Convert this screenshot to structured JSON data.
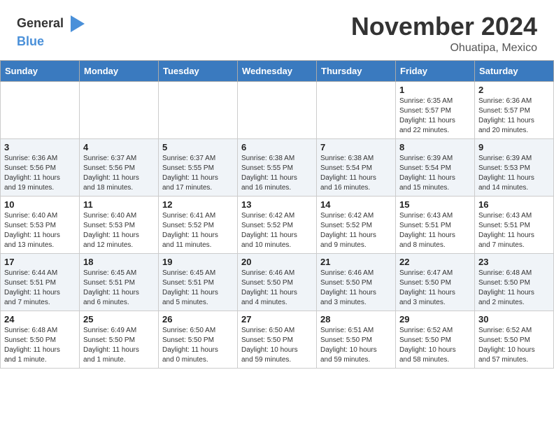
{
  "header": {
    "logo_general": "General",
    "logo_blue": "Blue",
    "month": "November 2024",
    "location": "Ohuatipa, Mexico"
  },
  "days_of_week": [
    "Sunday",
    "Monday",
    "Tuesday",
    "Wednesday",
    "Thursday",
    "Friday",
    "Saturday"
  ],
  "weeks": [
    [
      {
        "day": "",
        "info": ""
      },
      {
        "day": "",
        "info": ""
      },
      {
        "day": "",
        "info": ""
      },
      {
        "day": "",
        "info": ""
      },
      {
        "day": "",
        "info": ""
      },
      {
        "day": "1",
        "info": "Sunrise: 6:35 AM\nSunset: 5:57 PM\nDaylight: 11 hours\nand 22 minutes."
      },
      {
        "day": "2",
        "info": "Sunrise: 6:36 AM\nSunset: 5:57 PM\nDaylight: 11 hours\nand 20 minutes."
      }
    ],
    [
      {
        "day": "3",
        "info": "Sunrise: 6:36 AM\nSunset: 5:56 PM\nDaylight: 11 hours\nand 19 minutes."
      },
      {
        "day": "4",
        "info": "Sunrise: 6:37 AM\nSunset: 5:56 PM\nDaylight: 11 hours\nand 18 minutes."
      },
      {
        "day": "5",
        "info": "Sunrise: 6:37 AM\nSunset: 5:55 PM\nDaylight: 11 hours\nand 17 minutes."
      },
      {
        "day": "6",
        "info": "Sunrise: 6:38 AM\nSunset: 5:55 PM\nDaylight: 11 hours\nand 16 minutes."
      },
      {
        "day": "7",
        "info": "Sunrise: 6:38 AM\nSunset: 5:54 PM\nDaylight: 11 hours\nand 16 minutes."
      },
      {
        "day": "8",
        "info": "Sunrise: 6:39 AM\nSunset: 5:54 PM\nDaylight: 11 hours\nand 15 minutes."
      },
      {
        "day": "9",
        "info": "Sunrise: 6:39 AM\nSunset: 5:53 PM\nDaylight: 11 hours\nand 14 minutes."
      }
    ],
    [
      {
        "day": "10",
        "info": "Sunrise: 6:40 AM\nSunset: 5:53 PM\nDaylight: 11 hours\nand 13 minutes."
      },
      {
        "day": "11",
        "info": "Sunrise: 6:40 AM\nSunset: 5:53 PM\nDaylight: 11 hours\nand 12 minutes."
      },
      {
        "day": "12",
        "info": "Sunrise: 6:41 AM\nSunset: 5:52 PM\nDaylight: 11 hours\nand 11 minutes."
      },
      {
        "day": "13",
        "info": "Sunrise: 6:42 AM\nSunset: 5:52 PM\nDaylight: 11 hours\nand 10 minutes."
      },
      {
        "day": "14",
        "info": "Sunrise: 6:42 AM\nSunset: 5:52 PM\nDaylight: 11 hours\nand 9 minutes."
      },
      {
        "day": "15",
        "info": "Sunrise: 6:43 AM\nSunset: 5:51 PM\nDaylight: 11 hours\nand 8 minutes."
      },
      {
        "day": "16",
        "info": "Sunrise: 6:43 AM\nSunset: 5:51 PM\nDaylight: 11 hours\nand 7 minutes."
      }
    ],
    [
      {
        "day": "17",
        "info": "Sunrise: 6:44 AM\nSunset: 5:51 PM\nDaylight: 11 hours\nand 7 minutes."
      },
      {
        "day": "18",
        "info": "Sunrise: 6:45 AM\nSunset: 5:51 PM\nDaylight: 11 hours\nand 6 minutes."
      },
      {
        "day": "19",
        "info": "Sunrise: 6:45 AM\nSunset: 5:51 PM\nDaylight: 11 hours\nand 5 minutes."
      },
      {
        "day": "20",
        "info": "Sunrise: 6:46 AM\nSunset: 5:50 PM\nDaylight: 11 hours\nand 4 minutes."
      },
      {
        "day": "21",
        "info": "Sunrise: 6:46 AM\nSunset: 5:50 PM\nDaylight: 11 hours\nand 3 minutes."
      },
      {
        "day": "22",
        "info": "Sunrise: 6:47 AM\nSunset: 5:50 PM\nDaylight: 11 hours\nand 3 minutes."
      },
      {
        "day": "23",
        "info": "Sunrise: 6:48 AM\nSunset: 5:50 PM\nDaylight: 11 hours\nand 2 minutes."
      }
    ],
    [
      {
        "day": "24",
        "info": "Sunrise: 6:48 AM\nSunset: 5:50 PM\nDaylight: 11 hours\nand 1 minute."
      },
      {
        "day": "25",
        "info": "Sunrise: 6:49 AM\nSunset: 5:50 PM\nDaylight: 11 hours\nand 1 minute."
      },
      {
        "day": "26",
        "info": "Sunrise: 6:50 AM\nSunset: 5:50 PM\nDaylight: 11 hours\nand 0 minutes."
      },
      {
        "day": "27",
        "info": "Sunrise: 6:50 AM\nSunset: 5:50 PM\nDaylight: 10 hours\nand 59 minutes."
      },
      {
        "day": "28",
        "info": "Sunrise: 6:51 AM\nSunset: 5:50 PM\nDaylight: 10 hours\nand 59 minutes."
      },
      {
        "day": "29",
        "info": "Sunrise: 6:52 AM\nSunset: 5:50 PM\nDaylight: 10 hours\nand 58 minutes."
      },
      {
        "day": "30",
        "info": "Sunrise: 6:52 AM\nSunset: 5:50 PM\nDaylight: 10 hours\nand 57 minutes."
      }
    ]
  ]
}
